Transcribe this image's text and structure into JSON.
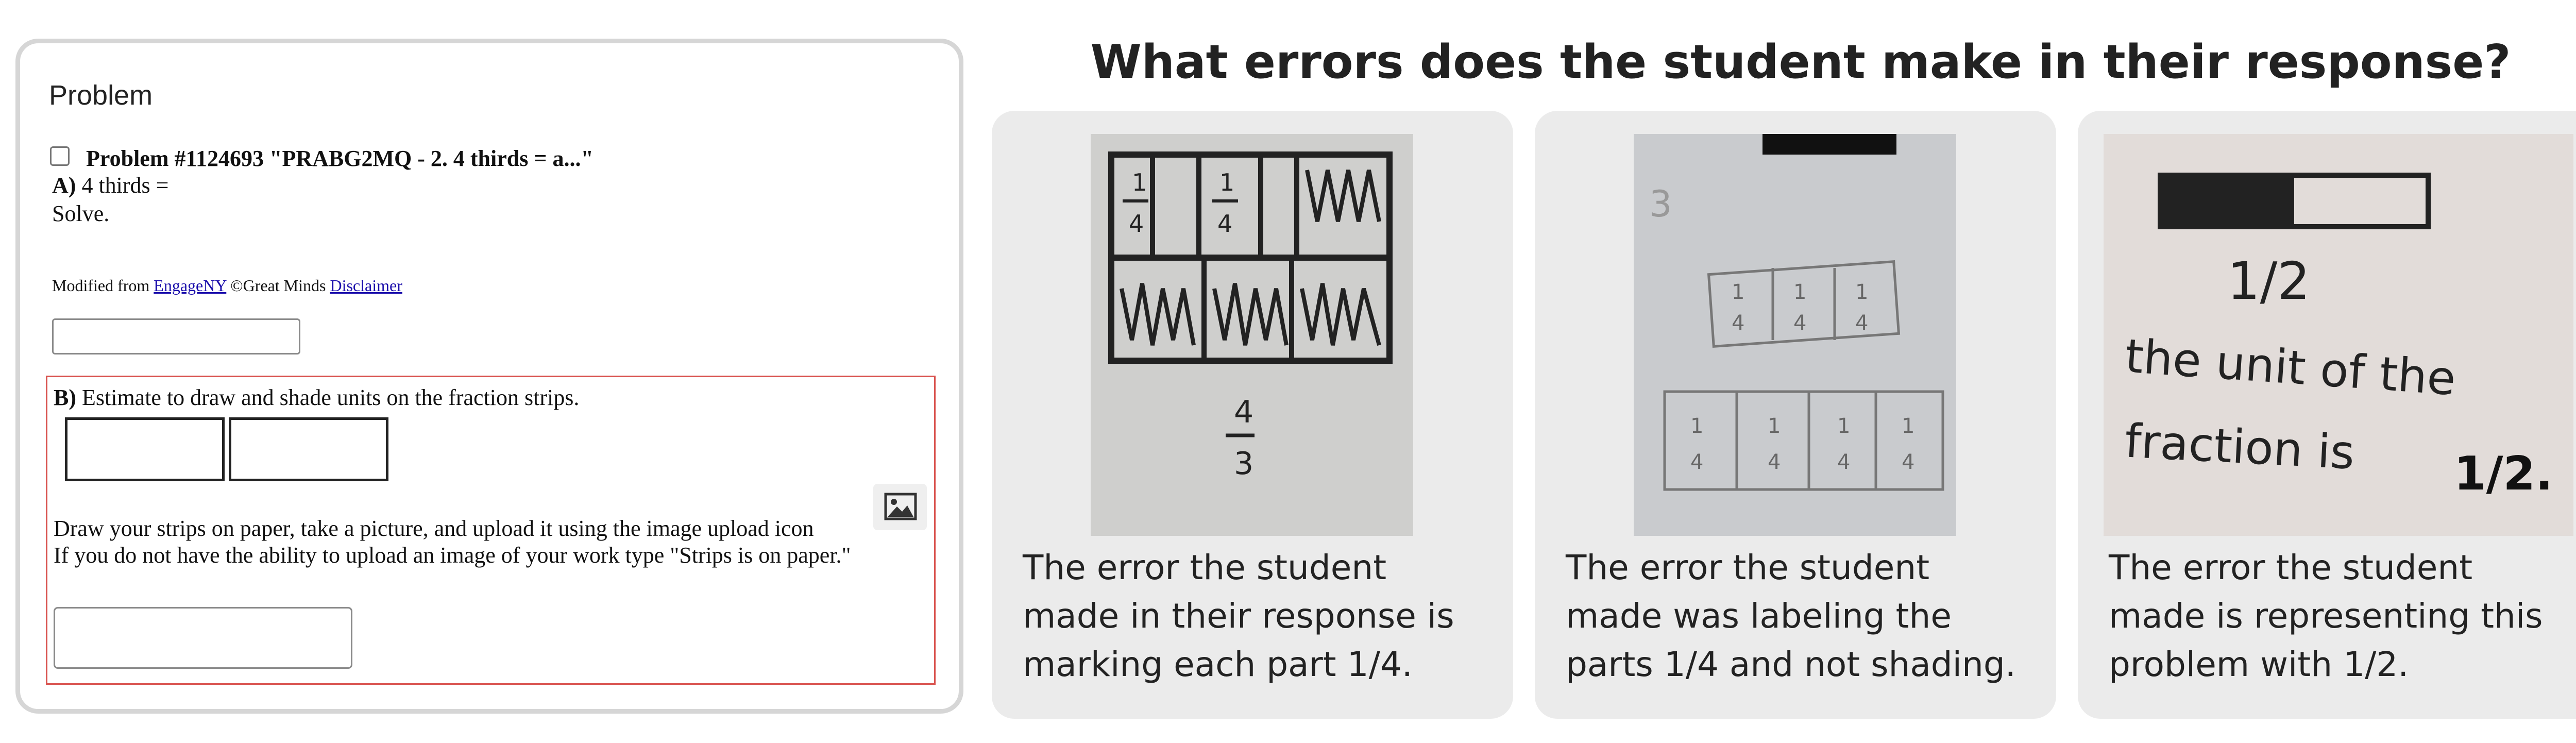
{
  "problem_panel": {
    "title": "Problem",
    "heading": "Problem #1124693 \"PRABG2MQ - 2. 4 thirds = a...\"",
    "part_a_label": "A)",
    "part_a_text": " 4 thirds =",
    "solve_text": "Solve.",
    "credit_prefix": "Modified from ",
    "credit_link_1": "EngageNY",
    "credit_middle": " ©Great Minds ",
    "credit_link_2": "Disclaimer",
    "part_b_label": "B)",
    "part_b_text": " Estimate to draw and shade units on the fraction strips.",
    "instruction_1": "Draw your strips on paper, take a picture, and upload it using the image upload icon",
    "instruction_2": "If you do not have the ability to upload an image of your work type \"Strips is on paper.\"",
    "answer_a_value": "",
    "answer_b_value": ""
  },
  "question": "What errors does the student make in their response?",
  "responses": [
    {
      "caption": "The error the student made in their response is marking each part 1/4.",
      "photo_text": {
        "l1": "1",
        "d1": "4",
        "l2": "1",
        "d2": "4",
        "l3": "4",
        "d3": "3"
      }
    },
    {
      "caption": "The error the student made was labeling the parts 1/4 and not shading.",
      "photo_text": {
        "n": "1",
        "d": "4",
        "margin": "3"
      }
    },
    {
      "caption": "The error the student made is representing this problem with 1/2.",
      "photo_text": {
        "fraction": "1/2",
        "line1": "the unit of the",
        "line2": "fraction is",
        "answer": "1/2."
      }
    }
  ]
}
